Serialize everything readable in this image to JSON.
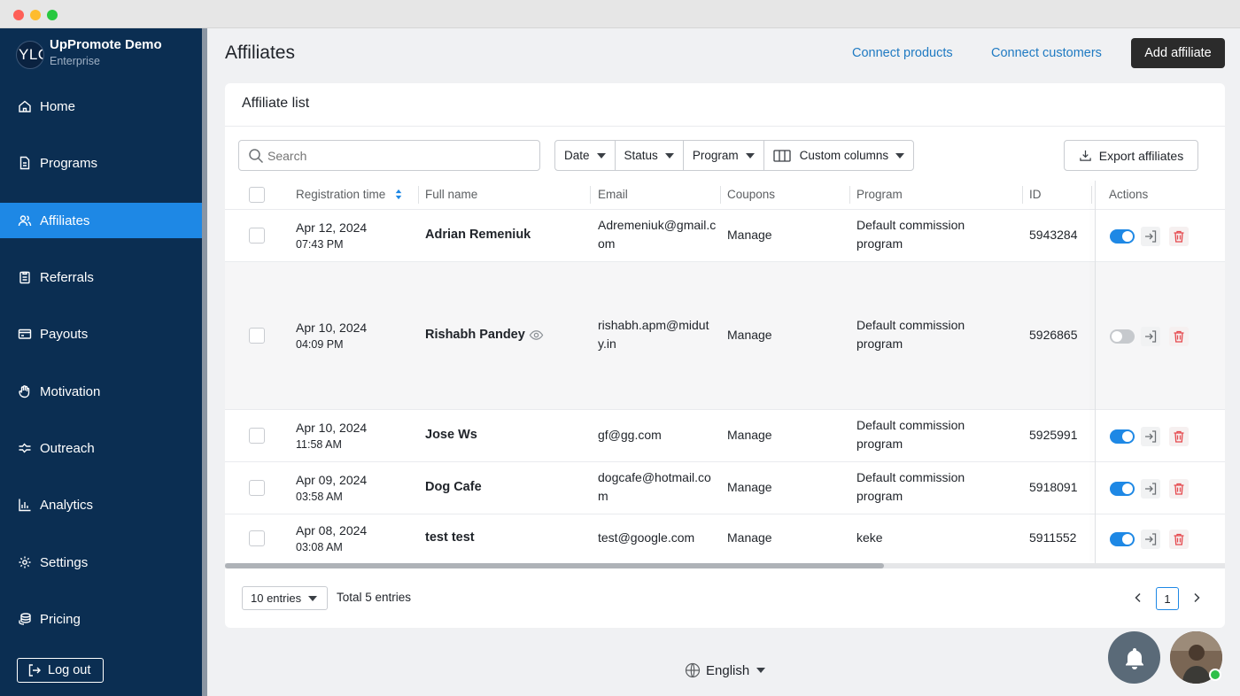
{
  "window": {
    "title": ""
  },
  "sidebar": {
    "brand_logo": "YLC",
    "brand_name": "UpPromote Demo",
    "brand_plan": "Enterprise",
    "items": [
      {
        "label": "Home",
        "icon": "home-icon",
        "active": false
      },
      {
        "label": "Programs",
        "icon": "document-icon",
        "active": false
      },
      {
        "label": "Affiliates",
        "icon": "users-icon",
        "active": true
      },
      {
        "label": "Referrals",
        "icon": "clipboard-icon",
        "active": false
      },
      {
        "label": "Payouts",
        "icon": "wallet-icon",
        "active": false
      },
      {
        "label": "Motivation",
        "icon": "hand-icon",
        "active": false
      },
      {
        "label": "Outreach",
        "icon": "outreach-icon",
        "active": false
      },
      {
        "label": "Analytics",
        "icon": "chart-icon",
        "active": false
      },
      {
        "label": "Settings",
        "icon": "gear-icon",
        "active": false
      },
      {
        "label": "Pricing",
        "icon": "coins-icon",
        "active": false
      }
    ],
    "logout_label": "Log out"
  },
  "header": {
    "title": "Affiliates",
    "connect_products": "Connect products",
    "connect_customers": "Connect customers",
    "add_affiliate": "Add affiliate"
  },
  "card": {
    "title": "Affiliate list",
    "search_placeholder": "Search",
    "filters": {
      "date": "Date",
      "status": "Status",
      "program": "Program",
      "custom_columns": "Custom columns"
    },
    "export_label": "Export affiliates"
  },
  "table": {
    "columns": {
      "registration_time": "Registration time",
      "full_name": "Full name",
      "email": "Email",
      "coupons": "Coupons",
      "program": "Program",
      "id": "ID",
      "actions": "Actions"
    },
    "rows": [
      {
        "date": "Apr 12, 2024",
        "time": "07:43 PM",
        "name": "Adrian Remeniuk",
        "email": "Adremeniuk@gmail.com",
        "coupons": "Manage",
        "program": "Default commission program",
        "id": "5943284",
        "active": true,
        "has_eye": false
      },
      {
        "date": "Apr 10, 2024",
        "time": "04:09 PM",
        "name": "Rishabh Pandey",
        "email": "rishabh.apm@miduty.in",
        "coupons": "Manage",
        "program": "Default commission program",
        "id": "5926865",
        "active": false,
        "has_eye": true
      },
      {
        "date": "Apr 10, 2024",
        "time": "11:58 AM",
        "name": "Jose Ws",
        "email": "gf@gg.com",
        "coupons": "Manage",
        "program": "Default commission program",
        "id": "5925991",
        "active": true,
        "has_eye": false
      },
      {
        "date": "Apr 09, 2024",
        "time": "03:58 AM",
        "name": "Dog Cafe",
        "email": "dogcafe@hotmail.com",
        "coupons": "Manage",
        "program": "Default commission program",
        "id": "5918091",
        "active": true,
        "has_eye": false
      },
      {
        "date": "Apr 08, 2024",
        "time": "03:08 AM",
        "name": "test test",
        "email": "test@google.com",
        "coupons": "Manage",
        "program": "keke",
        "id": "5911552",
        "active": true,
        "has_eye": false
      }
    ]
  },
  "pagination": {
    "entries_label": "10 entries",
    "total_label": "Total 5 entries",
    "current_page": "1"
  },
  "footer": {
    "language": "English"
  },
  "colors": {
    "sidebar_bg": "#0b2e52",
    "active_item": "#1e88e5",
    "link": "#1f7ac2",
    "primary_button": "#2b2b2b",
    "toggle_on": "#1e88e5",
    "delete_red": "#e5484d"
  }
}
